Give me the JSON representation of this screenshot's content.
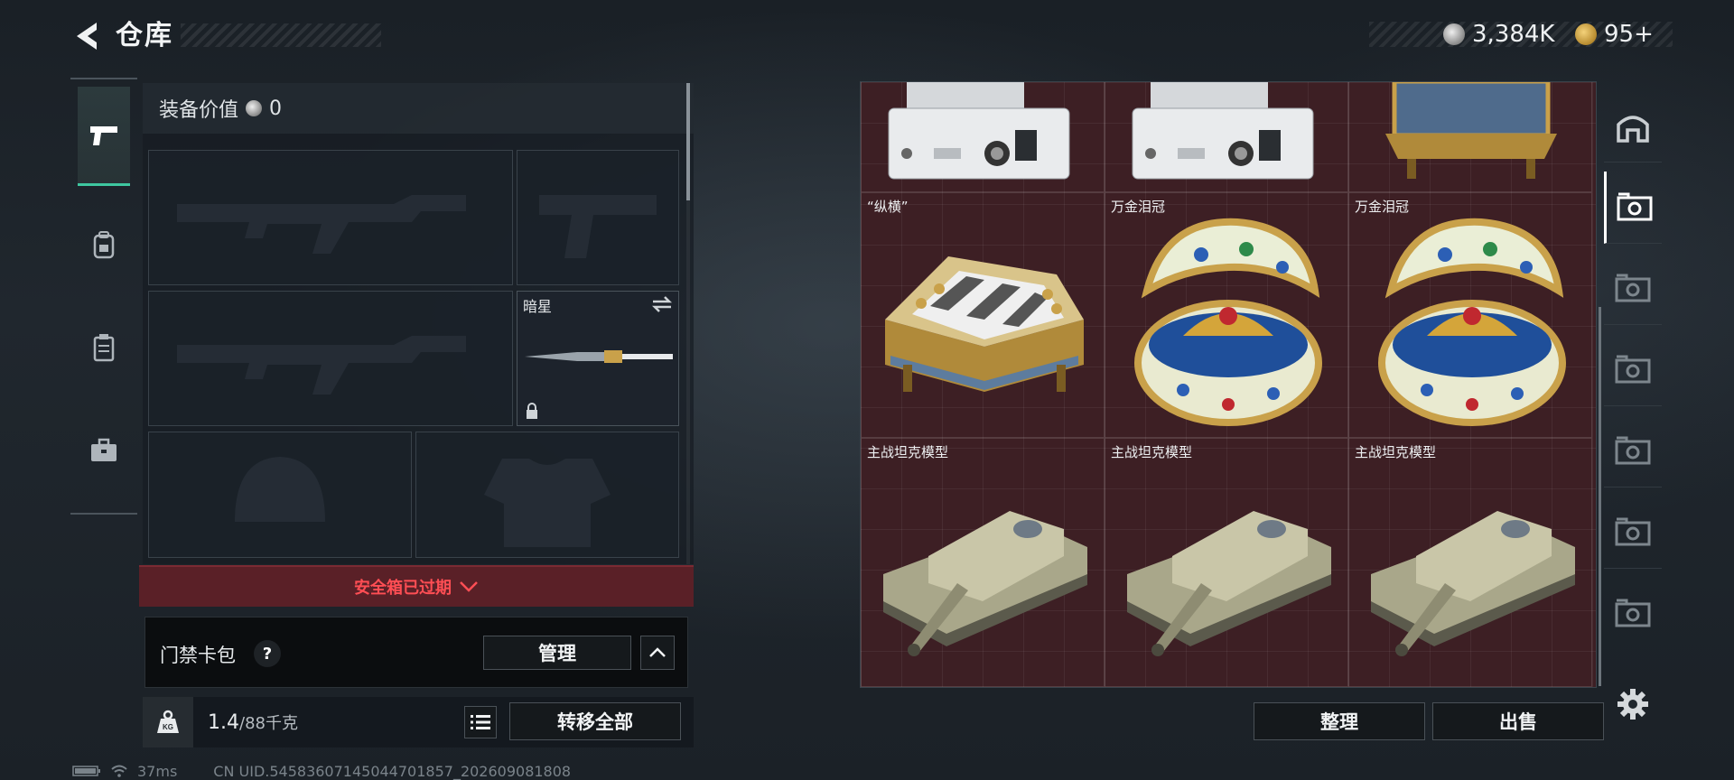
{
  "header": {
    "title": "仓库",
    "silver_amount": "3,384K",
    "gold_amount": "95+"
  },
  "equipment": {
    "value_label": "装备价值",
    "value_amount": "0",
    "knife_name": "暗星"
  },
  "safe_box": {
    "expired_text": "安全箱已过期"
  },
  "access_card": {
    "label": "门禁卡包",
    "help": "?",
    "manage_label": "管理"
  },
  "weight": {
    "current": "1.4",
    "max": "/88千克",
    "transfer_all_label": "转移全部"
  },
  "storage": {
    "items": [
      {
        "name": ""
      },
      {
        "name": ""
      },
      {
        "name": ""
      },
      {
        "name": "“纵横”"
      },
      {
        "name": "万金泪冠"
      },
      {
        "name": "万金泪冠"
      },
      {
        "name": "主战坦克模型"
      },
      {
        "name": "主战坦克模型"
      },
      {
        "name": "主战坦克模型"
      }
    ],
    "sort_label": "整理",
    "sell_label": "出售"
  },
  "status_bar": {
    "ping": "37ms",
    "uid": "CN UID.5458360714504470185​7_202609081808"
  },
  "colors": {
    "accent_green": "#3ec7a0",
    "warning_red": "#ff4e54",
    "grid_bg": "#3d1f24"
  },
  "icons": {
    "rail": [
      "pistol-icon",
      "backpack-icon",
      "vest-icon",
      "briefcase-icon"
    ],
    "right_rail": [
      "safehouse-icon",
      "storage-tab-icon",
      "storage-tab-icon",
      "storage-tab-icon",
      "storage-tab-icon",
      "storage-tab-icon",
      "storage-tab-icon"
    ]
  }
}
